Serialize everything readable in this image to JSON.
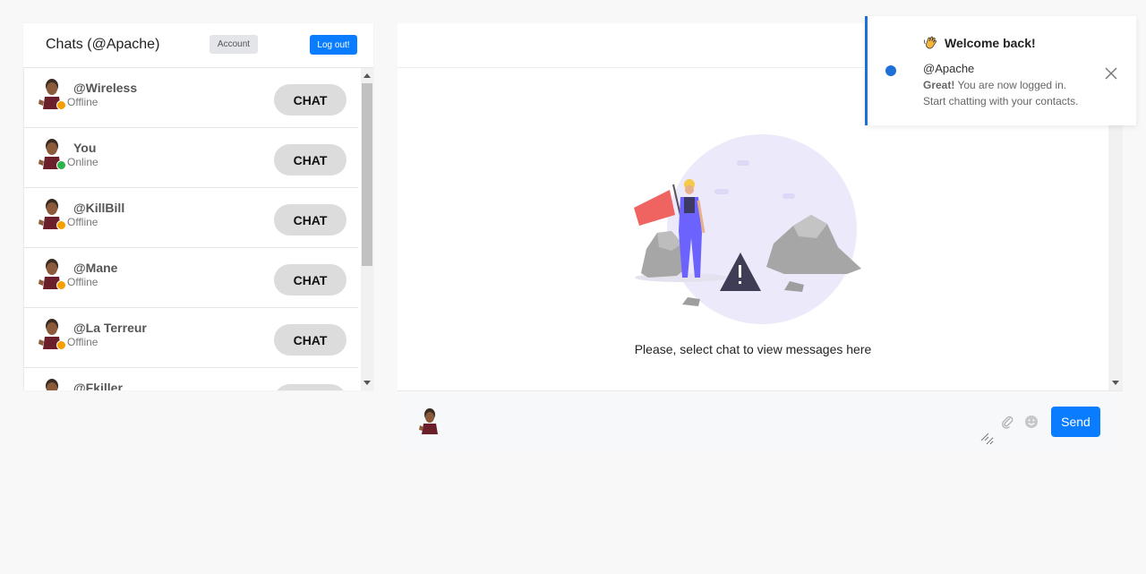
{
  "left_panel": {
    "title": "Chats (@Apache)",
    "account_label": "Account",
    "logout_label": "Log out!"
  },
  "contacts": [
    {
      "name": "@Wireless",
      "status": "Offline",
      "status_color": "#f5a000",
      "chat_label": "CHAT",
      "avatar": "bitmoji-avatar"
    },
    {
      "name": "You",
      "status": "Online",
      "status_color": "#2bb24c",
      "chat_label": "CHAT",
      "avatar": "bitmoji-avatar"
    },
    {
      "name": "@KillBill",
      "status": "Offline",
      "status_color": "#f5a000",
      "chat_label": "CHAT",
      "avatar": "bitmoji-avatar"
    },
    {
      "name": "@Mane",
      "status": "Offline",
      "status_color": "#f5a000",
      "chat_label": "CHAT",
      "avatar": "bitmoji-avatar"
    },
    {
      "name": "@La Terreur",
      "status": "Offline",
      "status_color": "#f5a000",
      "chat_label": "CHAT",
      "avatar": "bitmoji-avatar"
    },
    {
      "name": "@Fkiller",
      "status": "",
      "status_color": "#f5a000",
      "chat_label": "",
      "avatar": "bitmoji-avatar"
    }
  ],
  "main": {
    "empty_message": "Please, select chat to view messages here"
  },
  "composer": {
    "send_label": "Send",
    "attach_icon": "paperclip-icon",
    "emoji_icon": "smiley-icon"
  },
  "toast": {
    "title": "Welcome back!",
    "icon": "waving-hand-icon",
    "user": "@Apache",
    "message_bold": "Great!",
    "message_rest": " You are now logged in.",
    "message_line2": "Start chatting with your contacts."
  },
  "colors": {
    "accent": "#0a7cff",
    "toast_accent": "#1f6fd8",
    "offline": "#f5a000",
    "online": "#2bb24c"
  }
}
